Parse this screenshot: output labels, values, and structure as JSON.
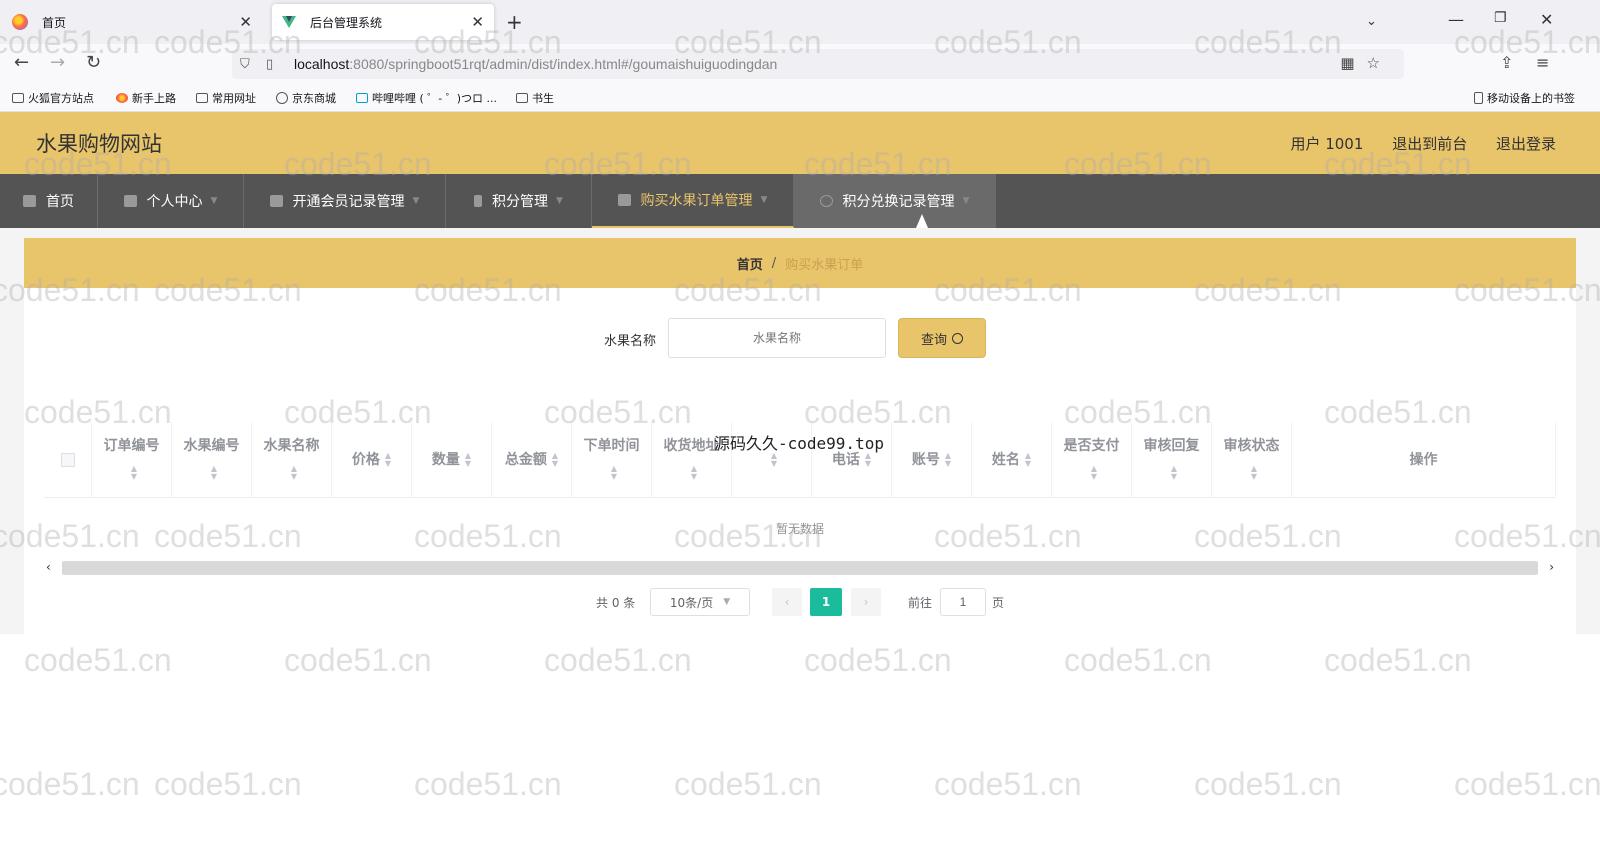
{
  "browser": {
    "tabs": [
      {
        "label": "首页",
        "active": false
      },
      {
        "label": "后台管理系统",
        "active": true
      }
    ],
    "url": {
      "host": "localhost",
      "path": ":8080/springboot51rqt/admin/dist/index.html#/goumaishuiguodingdan"
    },
    "bookmarks": [
      "火狐官方站点",
      "新手上路",
      "常用网址",
      "京东商城",
      "哔哩哔哩 ( ゜- ゜)つロ ...",
      "书生",
      "移动设备上的书签"
    ]
  },
  "app": {
    "title": "水果购物网站",
    "user_label": "用户 1001",
    "to_front_label": "退出到前台",
    "logout_label": "退出登录",
    "accent_color": "#e8c46b"
  },
  "menu": {
    "items": [
      {
        "label": "首页",
        "icon": "home-icon",
        "has_caret": false
      },
      {
        "label": "个人中心",
        "icon": "user-icon",
        "has_caret": true
      },
      {
        "label": "开通会员记录管理",
        "icon": "record-icon",
        "has_caret": true
      },
      {
        "label": "积分管理",
        "icon": "points-icon",
        "has_caret": true
      },
      {
        "label": "购买水果订单管理",
        "icon": "monitor-icon",
        "has_caret": true,
        "active": true
      },
      {
        "label": "积分兑换记录管理",
        "icon": "power-icon",
        "has_caret": true,
        "hover": true
      }
    ]
  },
  "breadcrumb": {
    "home": "首页",
    "separator": "/",
    "current": "购买水果订单"
  },
  "search": {
    "label": "水果名称",
    "placeholder": "水果名称",
    "value": "",
    "button_label": "查询"
  },
  "table": {
    "columns": [
      {
        "label": "订单编号",
        "sortable": true
      },
      {
        "label": "水果编号",
        "sortable": true
      },
      {
        "label": "水果名称",
        "sortable": true
      },
      {
        "label": "价格",
        "sortable": true
      },
      {
        "label": "数量",
        "sortable": true
      },
      {
        "label": "总金额",
        "sortable": true
      },
      {
        "label": "下单时间",
        "sortable": true
      },
      {
        "label": "收货地址",
        "sortable": true
      },
      {
        "label": "",
        "sortable": true
      },
      {
        "label": "电话",
        "sortable": true
      },
      {
        "label": "账号",
        "sortable": true
      },
      {
        "label": "姓名",
        "sortable": true
      },
      {
        "label": "是否支付",
        "sortable": true
      },
      {
        "label": "审核回复",
        "sortable": true
      },
      {
        "label": "审核状态",
        "sortable": true
      },
      {
        "label": "操作",
        "sortable": false
      }
    ],
    "rows": [],
    "empty_text": "暂无数据",
    "overlay_text": "源码久久-code99.top"
  },
  "pagination": {
    "total_text": "共 0 条",
    "page_size": "10条/页",
    "current_page": "1",
    "goto_label": "前往",
    "goto_value": "1",
    "page_suffix": "页"
  },
  "watermark": "code51.cn"
}
